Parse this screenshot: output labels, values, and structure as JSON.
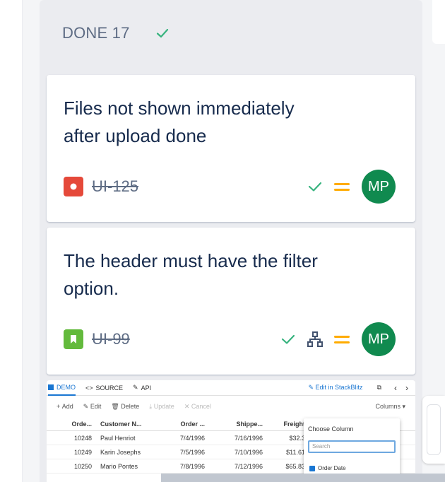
{
  "column": {
    "title": "DONE 17",
    "status_icon": "check-icon",
    "colors": {
      "check": "#36b37e",
      "title": "#5e6c84"
    }
  },
  "cards": [
    {
      "title": "Files not shown immediately after upload done",
      "issue_type": "bug",
      "issue_key": "UI-125",
      "resolved_icon": "check-icon",
      "priority": "medium",
      "avatar": "MP",
      "colors": {
        "issue_type": "#e5493a",
        "priority": "#ffab00",
        "avatar": "#108a4f"
      }
    },
    {
      "title": "The header must have the filter option.",
      "issue_type": "story",
      "issue_key": "UI-99",
      "resolved_icon": "check-icon",
      "child_issues_icon": "hierarchy-icon",
      "priority": "medium",
      "avatar": "MP",
      "colors": {
        "issue_type": "#63ba3c",
        "priority": "#ffab00",
        "avatar": "#108a4f"
      }
    }
  ],
  "attachment": {
    "tabs": [
      "DEMO",
      "SOURCE",
      "API"
    ],
    "edit_link": "Edit in StackBlitz",
    "toolbar": [
      "Add",
      "Edit",
      "Delete",
      "Update",
      "Cancel"
    ],
    "columns_button": "Columns",
    "headers": [
      "Orde...",
      "Customer N...",
      "Order ...",
      "Shippe...",
      "Freight"
    ],
    "rows": [
      [
        "10248",
        "Paul Henriot",
        "7/4/1996",
        "7/16/1996",
        "$32.3"
      ],
      [
        "10249",
        "Karin Josephs",
        "7/5/1996",
        "7/10/1996",
        "$11.61"
      ],
      [
        "10250",
        "Mario Pontes",
        "7/8/1996",
        "7/12/1996",
        "$65.83"
      ]
    ],
    "chooser": {
      "title": "Choose Column",
      "search_placeholder": "Search",
      "first_item": "Order Date"
    }
  }
}
